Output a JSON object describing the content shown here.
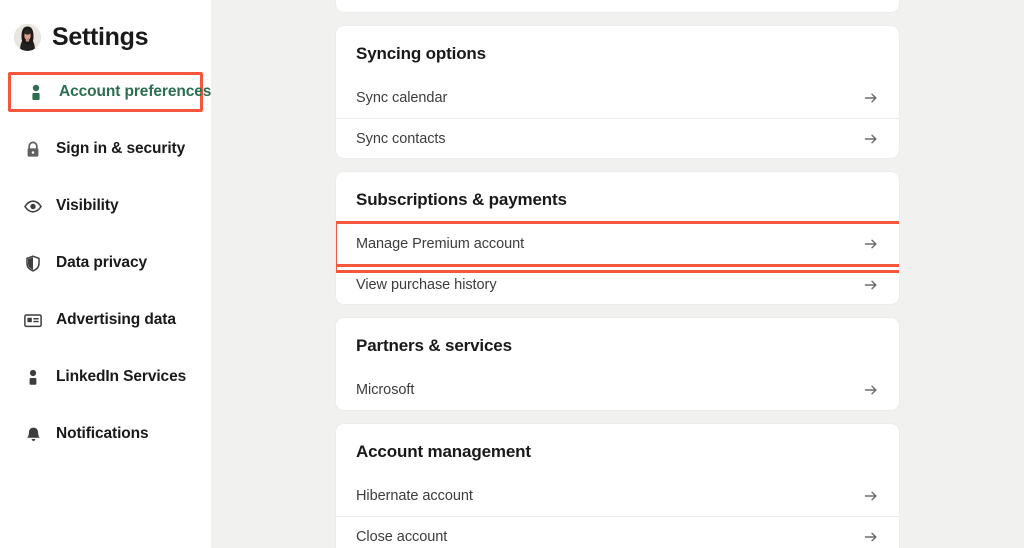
{
  "sidebar": {
    "title": "Settings",
    "avatar_alt": "user-avatar",
    "items": [
      {
        "label": "Account preferences",
        "icon": "person-icon",
        "active": true,
        "highlighted": true
      },
      {
        "label": "Sign in & security",
        "icon": "lock-icon",
        "active": false,
        "highlighted": false
      },
      {
        "label": "Visibility",
        "icon": "eye-icon",
        "active": false,
        "highlighted": false
      },
      {
        "label": "Data privacy",
        "icon": "shield-icon",
        "active": false,
        "highlighted": false
      },
      {
        "label": "Advertising data",
        "icon": "ad-card-icon",
        "active": false,
        "highlighted": false
      },
      {
        "label": "LinkedIn Services",
        "icon": "person-icon",
        "active": false,
        "highlighted": false
      },
      {
        "label": "Notifications",
        "icon": "bell-icon",
        "active": false,
        "highlighted": false
      }
    ]
  },
  "main": {
    "cards": [
      {
        "title": "Syncing options",
        "rows": [
          {
            "label": "Sync calendar",
            "arrow": "arrow-right-icon",
            "highlighted": false
          },
          {
            "label": "Sync contacts",
            "arrow": "arrow-right-icon",
            "highlighted": false
          }
        ]
      },
      {
        "title": "Subscriptions & payments",
        "rows": [
          {
            "label": "Manage Premium account",
            "arrow": "arrow-right-icon",
            "highlighted": true
          },
          {
            "label": "View purchase history",
            "arrow": "arrow-right-icon",
            "highlighted": false
          }
        ]
      },
      {
        "title": "Partners & services",
        "rows": [
          {
            "label": "Microsoft",
            "arrow": "arrow-right-icon",
            "highlighted": false
          }
        ]
      },
      {
        "title": "Account management",
        "rows": [
          {
            "label": "Hibernate account",
            "arrow": "arrow-right-icon",
            "highlighted": false
          },
          {
            "label": "Close account",
            "arrow": "arrow-right-icon",
            "highlighted": false
          }
        ]
      }
    ]
  },
  "colors": {
    "accent_green": "#2c6e4f",
    "highlight_red": "#f4573c",
    "page_background": "#f1f2ef",
    "card_background": "#ffffff",
    "text_primary": "#191919",
    "text_secondary": "#3d3d3d"
  }
}
